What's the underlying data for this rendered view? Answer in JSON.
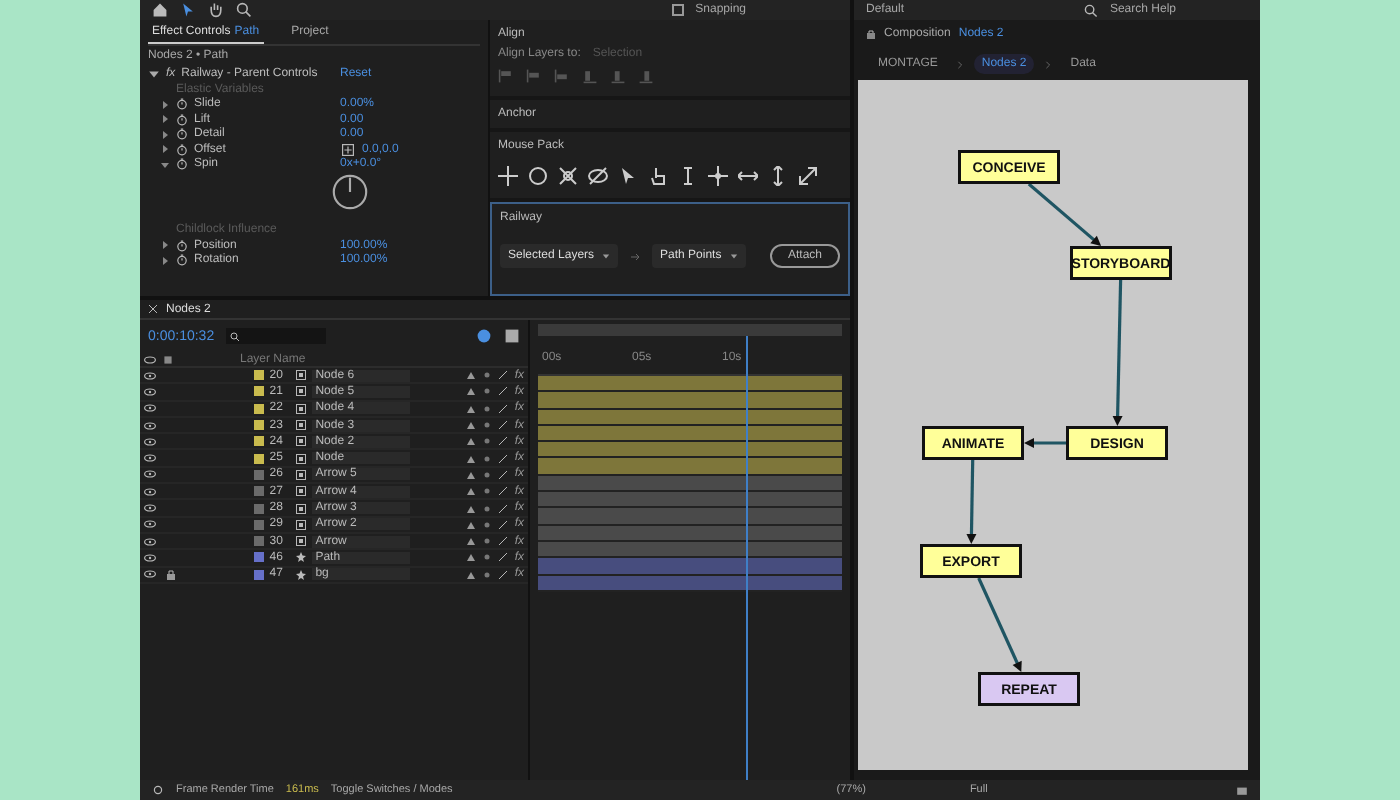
{
  "toolbar": {
    "snapping": "Snapping",
    "snapping_on": false,
    "workspace": "Default",
    "search_placeholder": "Search Help"
  },
  "effect_controls": {
    "tabs": [
      {
        "label": "Effect Controls",
        "target": "Path",
        "selected": true
      },
      {
        "label": "Project",
        "selected": false
      }
    ],
    "breadcrumb": "Nodes 2 • Path",
    "effect": {
      "badge": "fx",
      "name": "Railway - Parent Controls",
      "reset": "Reset",
      "expanded": true
    },
    "groups": [
      {
        "heading": "Elastic Variables",
        "properties": [
          {
            "name": "Slide",
            "value": "0.00%",
            "kind": "number",
            "expanded": false
          },
          {
            "name": "Lift",
            "value": "0.00",
            "kind": "number",
            "expanded": false
          },
          {
            "name": "Detail",
            "value": "0.00",
            "kind": "number",
            "expanded": false
          },
          {
            "name": "Offset",
            "value": "0.0,0.0",
            "kind": "point",
            "expanded": false
          },
          {
            "name": "Spin",
            "value": "0x+0.0°",
            "kind": "angle",
            "expanded": true
          }
        ]
      },
      {
        "heading": "Childlock Influence",
        "properties": [
          {
            "name": "Position",
            "value": "100.00%",
            "kind": "number",
            "expanded": false
          },
          {
            "name": "Rotation",
            "value": "100.00%",
            "kind": "number",
            "expanded": false
          }
        ]
      }
    ]
  },
  "align": {
    "title": "Align",
    "label": "Align Layers to:",
    "target": "Selection"
  },
  "anchor": {
    "title": "Anchor"
  },
  "mouse_pack": {
    "title": "Mouse Pack"
  },
  "railway": {
    "title": "Railway",
    "focused": true,
    "mode": "Selected Layers",
    "target": "Path Points",
    "button": "Attach"
  },
  "composition": {
    "title": "Composition",
    "name": "Nodes 2",
    "breadcrumbs": [
      {
        "label": "MONTAGE",
        "selected": false
      },
      {
        "label": "Nodes 2",
        "selected": true
      },
      {
        "label": "Data",
        "selected": false
      }
    ],
    "nodes": [
      {
        "label": "CONCEIVE",
        "color": "#ffff99"
      },
      {
        "label": "STORYBOARD",
        "color": "#ffff99"
      },
      {
        "label": "DESIGN",
        "color": "#ffff99"
      },
      {
        "label": "ANIMATE",
        "color": "#ffff99"
      },
      {
        "label": "EXPORT",
        "color": "#ffff99"
      },
      {
        "label": "REPEAT",
        "color": "#d9c8f2"
      }
    ]
  },
  "timeline": {
    "tab": "Nodes 2",
    "timecode": "0:00:10:32",
    "column": "Layer Name",
    "ruler": [
      "00s",
      "05s",
      "10s"
    ],
    "layers": [
      {
        "number": "20",
        "name": "Node 6",
        "kind": "precomp",
        "color": "#c9bb4e",
        "locked": false,
        "fx": "fx"
      },
      {
        "number": "21",
        "name": "Node 5",
        "kind": "precomp",
        "color": "#c9bb4e",
        "locked": false,
        "fx": "fx"
      },
      {
        "number": "22",
        "name": "Node 4",
        "kind": "precomp",
        "color": "#c9bb4e",
        "locked": false,
        "fx": "fx"
      },
      {
        "number": "23",
        "name": "Node 3",
        "kind": "precomp",
        "color": "#c9bb4e",
        "locked": false,
        "fx": "fx"
      },
      {
        "number": "24",
        "name": "Node 2",
        "kind": "precomp",
        "color": "#c9bb4e",
        "locked": false,
        "fx": "fx"
      },
      {
        "number": "25",
        "name": "Node",
        "kind": "precomp",
        "color": "#c9bb4e",
        "locked": false,
        "fx": "fx"
      },
      {
        "number": "26",
        "name": "Arrow 5",
        "kind": "precomp",
        "color": "#6b6b6b",
        "locked": false,
        "fx": "fx"
      },
      {
        "number": "27",
        "name": "Arrow 4",
        "kind": "precomp",
        "color": "#6b6b6b",
        "locked": false,
        "fx": "fx"
      },
      {
        "number": "28",
        "name": "Arrow 3",
        "kind": "precomp",
        "color": "#6b6b6b",
        "locked": false,
        "fx": "fx"
      },
      {
        "number": "29",
        "name": "Arrow 2",
        "kind": "precomp",
        "color": "#6b6b6b",
        "locked": false,
        "fx": "fx"
      },
      {
        "number": "30",
        "name": "Arrow",
        "kind": "precomp",
        "color": "#6b6b6b",
        "locked": false,
        "fx": "fx"
      },
      {
        "number": "46",
        "name": "Path",
        "kind": "shape",
        "color": "#6670c9",
        "locked": false,
        "fx": "fx"
      },
      {
        "number": "47",
        "name": "bg",
        "kind": "shape",
        "color": "#6670c9",
        "locked": true,
        "fx": "fx"
      }
    ]
  },
  "status_bar": {
    "label": "Frame Render Time",
    "value": "161ms",
    "toggle": "Toggle Switches / Modes",
    "zoom": "(77%)",
    "resolution": "Full"
  }
}
